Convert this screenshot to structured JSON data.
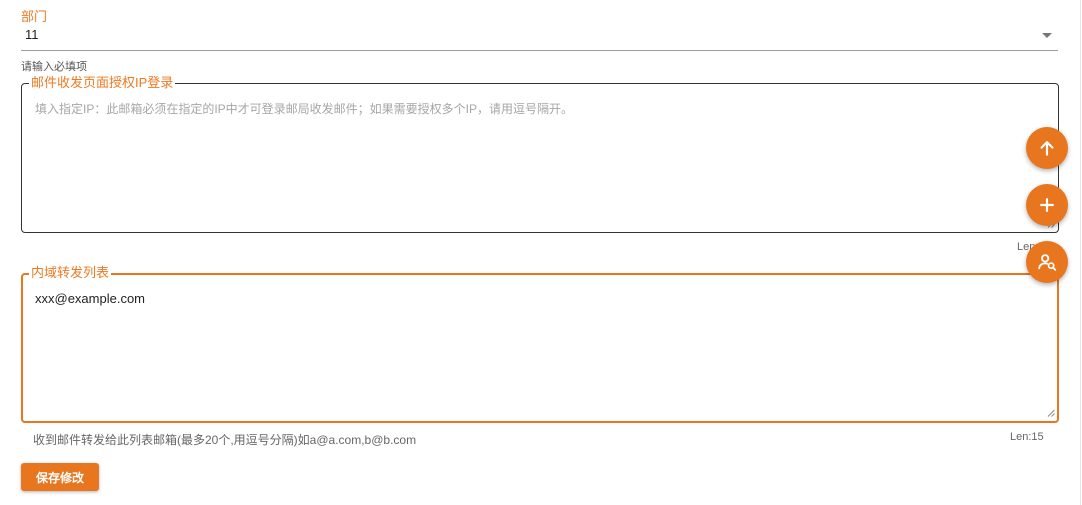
{
  "department": {
    "label": "部门",
    "value": "11",
    "helper": "请输入必填项"
  },
  "ip_login": {
    "label": "邮件收发页面授权IP登录",
    "placeholder": "填入指定IP：此邮箱必须在指定的IP中才可登录邮局收发邮件；如果需要授权多个IP，请用逗号隔开。",
    "len_text": "Len"
  },
  "forward_list": {
    "label": "内域转发列表",
    "value": "xxx@example.com",
    "helper": "收到邮件转发给此列表邮箱(最多20个,用逗号分隔)如a@a.com,b@b.com",
    "len_text": "Len:15"
  },
  "save_label": "保存修改",
  "colors": {
    "accent": "#e8761e",
    "label": "#ee7a22"
  },
  "fabs": [
    "arrow-up-icon",
    "plus-icon",
    "user-search-icon"
  ]
}
